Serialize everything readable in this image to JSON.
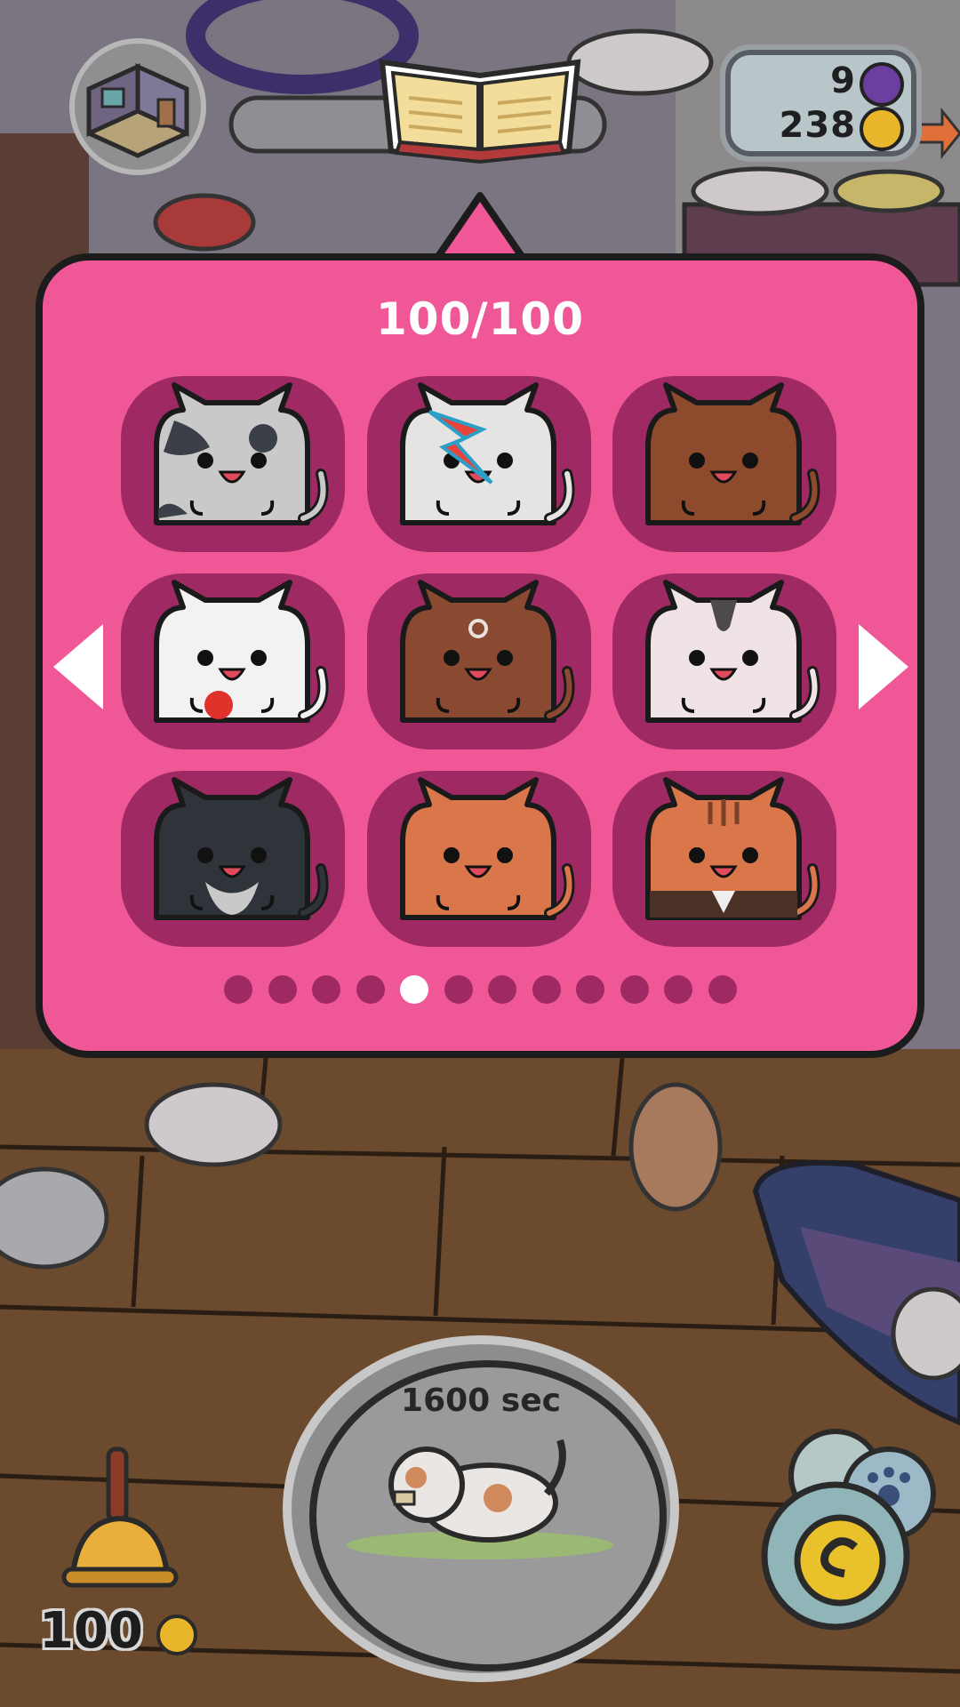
{
  "hud": {
    "gems": "9",
    "coins": "238",
    "gem_icon": "purple-gem-icon",
    "coin_icon": "gold-coin-icon"
  },
  "catalog": {
    "counter": "100/100",
    "page_count": 12,
    "active_page": 5,
    "cats": [
      {
        "name": "gray-patch-cat",
        "body": "#c9c9c9",
        "accent": "#3b3f47"
      },
      {
        "name": "bolt-cat",
        "body": "#e6e4e2",
        "accent": "#e8433c"
      },
      {
        "name": "brown-cat",
        "body": "#8e4a2c",
        "accent": "#6b3620"
      },
      {
        "name": "white-red-dot-cat",
        "body": "#f2f2f2",
        "accent": "#e0322a"
      },
      {
        "name": "brown-bindi-cat",
        "body": "#8a4a32",
        "accent": "#e8e0dc"
      },
      {
        "name": "white-stripe-cat",
        "body": "#efe3e6",
        "accent": "#4d4a49"
      },
      {
        "name": "tuxedo-black-cat",
        "body": "#2f343a",
        "accent": "#c9c9c9"
      },
      {
        "name": "orange-cat",
        "body": "#d9774b",
        "accent": "#c8653e"
      },
      {
        "name": "orange-suit-cat",
        "body": "#d9774b",
        "accent": "#4a3126"
      }
    ]
  },
  "timer": {
    "label": "1600 sec"
  },
  "bell": {
    "price": "100"
  },
  "colors": {
    "panel": "#f05797",
    "tile": "#9f2a63",
    "dot": "#9f2a63",
    "dot_active": "#ffffff"
  }
}
